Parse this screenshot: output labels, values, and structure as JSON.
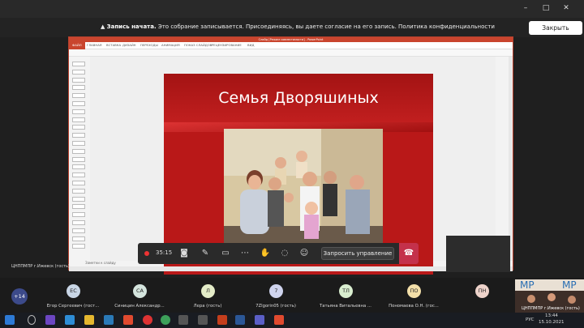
{
  "banner": {
    "title": "Запись начата.",
    "text": "Это собрание записывается. Присоединяясь, вы даете согласие на его запись. Политика конфиденциальности",
    "close_label": "Закрыть"
  },
  "window_controls": {
    "minimize": "–",
    "maximize": "□",
    "close": "✕"
  },
  "ppt": {
    "window_title": "Слайд [Режим совместимости] - PowerPoint",
    "tabs": [
      "ФАЙЛ",
      "ГЛАВНАЯ",
      "ВСТАВКА",
      "ДИЗАЙН",
      "ПЕРЕХОДЫ",
      "АНИМАЦИЯ",
      "ПОКАЗ СЛАЙДОВ",
      "РЕЦЕНЗИРОВАНИЕ",
      "ВИД"
    ],
    "notes_placeholder": "Заметки к слайду",
    "slide_title": "Семья Дворяшиных"
  },
  "meeting": {
    "timer": "35:15",
    "request_control_label": "Запросить управление",
    "local_label": "ЦНППМПР г.Ижевск (гость)",
    "more_count": "+14",
    "participants": [
      {
        "initials": "ЕС",
        "name": "Егор Сергеевич (гост...",
        "color": "#c9d6e6"
      },
      {
        "initials": "СА",
        "name": "Синицин Александр...",
        "color": "#d4e4dd"
      },
      {
        "initials": "Л",
        "name": "Лера (гость)",
        "color": "#e4ecc8"
      },
      {
        "initials": "7",
        "name": "7Zlgorin05 (гость)",
        "color": "#cfd4ee"
      },
      {
        "initials": "ТЛ",
        "name": "Татьяна Витальевна ...",
        "color": "#d9eecf"
      },
      {
        "initials": "ПО",
        "name": "Пономаева О.Н. (гос...",
        "color": "#f3dfa9"
      },
      {
        "initials": "ПН",
        "name": "",
        "color": "#eed3cb"
      }
    ],
    "room_label": "ЦНППМПР г.Ижевск (гость)"
  },
  "taskbar": {
    "lang": "РУС",
    "time": "13:44",
    "date": "15.10.2021"
  }
}
